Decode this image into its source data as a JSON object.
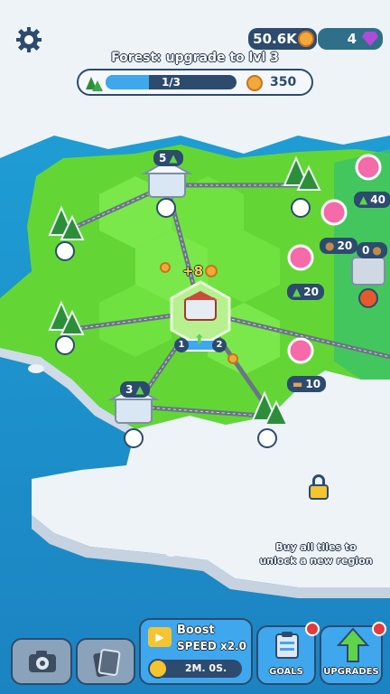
{
  "currency": {
    "coins": "50.6K",
    "gems": "4"
  },
  "quest": {
    "title": "Forest: upgrade to lvl 3",
    "progress_text": "1/3",
    "progress": 0.33,
    "reward": "350"
  },
  "map": {
    "floating_coin_text": "+8",
    "node_levels": {
      "left": "1",
      "right": "2"
    },
    "tile_badges": {
      "top_left": "5",
      "bottom_left": "3",
      "right_factory": "0"
    },
    "cost_badges": {
      "b1": "40",
      "b2": "20",
      "b3": "20",
      "b4": "10"
    },
    "unlock_hint": "Buy all tiles to\nunlock a new region"
  },
  "bottom_bar": {
    "boost_title": "Boost",
    "boost_effect": "SPEED x2.0",
    "boost_timer": "2M. 0S.",
    "goals_label": "GOALS",
    "upgrades_label": "UPGRADES"
  },
  "colors": {
    "grass": "#6fe23a",
    "ocean": "#1d8fc9",
    "snow": "#eef3f8",
    "panel": "#2c4b6e",
    "accent": "#3fa7ee"
  }
}
